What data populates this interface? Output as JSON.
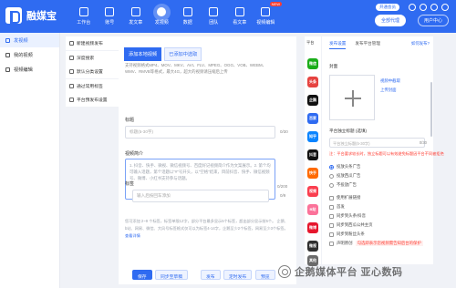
{
  "app": {
    "logo_text": "融媒宝"
  },
  "nav": [
    {
      "label": "工作台"
    },
    {
      "label": "账号"
    },
    {
      "label": "发文章"
    },
    {
      "label": "发视频"
    },
    {
      "label": "数据"
    },
    {
      "label": "团队"
    },
    {
      "label": "看文章"
    },
    {
      "label": "视频编辑",
      "badge": "NEW"
    }
  ],
  "top_right": {
    "vip": "开通会员",
    "all_button": "全部代理",
    "user_button": "用户中心"
  },
  "sidebar": [
    {
      "label": "发视频"
    },
    {
      "label": "我的视频"
    },
    {
      "label": "视频编辑"
    }
  ],
  "tools": [
    {
      "label": "新建视频发布"
    },
    {
      "label": "深度搜索"
    },
    {
      "label": "默认分类设置"
    },
    {
      "label": "通过常用标签"
    },
    {
      "label": "平台预发布设置"
    }
  ],
  "main": {
    "tab_local": "添加本地视频",
    "tab_selected": "已添加中选取",
    "formats": "支持视频格式MP4、MOV、MKV、AVI、FLV、MPEG、OGG、VOB、WEBM、WMV、RMVB等格式，最大4G，超大的视频请压缩后上传",
    "title_label": "标题",
    "title_placeholder": "标题(5-30字)",
    "title_counter": "0/30",
    "summary_label": "视频简介",
    "summary_placeholder": "1. 抖音、快手、微视、微信视频号、百度好记视频简介作为文案展示。2. 第个均可输入话题，第个话题以\"#\"号开头，以\"空格\"结束，目前抖音、快手、微信视频号、微博、小红书支持参与话题。",
    "summary_counter": "0/200",
    "tags_label": "标签",
    "tags_placeholder": "输入后按回车添加",
    "tags_counter": "0/9",
    "tips": "您可添加 2~9 个标签，标签单限12字，部分平台最多显示5个标签，超出部分显示前5个。 企鹅、b站、网易、微信、大风号标签格式仅可以为标签4-14字，企鹅至少2个标签，网易至少3个标签。",
    "tips_link": "查看详情"
  },
  "bottom_buttons": [
    {
      "label": "保存"
    },
    {
      "label": "同步至草稿"
    },
    {
      "label": "发布"
    },
    {
      "label": "定时发布"
    },
    {
      "label": "预览"
    }
  ],
  "platforms": {
    "label": "平台",
    "items": [
      {
        "name": "微信",
        "color": "#1aad19"
      },
      {
        "name": "头条",
        "color": "#e64340"
      },
      {
        "name": "企鹅",
        "color": "#111111"
      },
      {
        "name": "百家",
        "color": "#2f6bf1"
      },
      {
        "name": "知乎",
        "color": "#0a84ff"
      },
      {
        "name": "抖音",
        "color": "#111111"
      },
      {
        "name": "快手",
        "color": "#ff6a00"
      },
      {
        "name": "视频",
        "color": "#fa3e4f"
      },
      {
        "name": "B站",
        "color": "#fb7299"
      },
      {
        "name": "微博",
        "color": "#e6162d"
      },
      {
        "name": "微视",
        "color": "#2f2f2f"
      },
      {
        "name": "其他",
        "color": "#6a6a6a"
      }
    ]
  },
  "settings": {
    "tab_publish": "发布设置",
    "tab_platform": "发布平台管理",
    "help": "如何发布?",
    "cover_label": "封面",
    "cover_select": "视频中截取",
    "cover_upload": "上传封面",
    "platform_title_label": "平台独立标题 (选填)",
    "platform_title_placeholder": "平台独立标题(5-30字)",
    "platform_title_counter": "0/30",
    "warning": "注：平台要求较长时，独立标题可以有效避免标题因平台不同被拒绝",
    "radio_options": [
      {
        "label": "投放头条广告",
        "checked": true
      },
      {
        "label": "投放西瓜广告",
        "checked": false
      },
      {
        "label": "不投放广告",
        "checked": false
      }
    ],
    "checkbox_options": [
      {
        "label": "使用扩展链接"
      },
      {
        "label": "首发"
      },
      {
        "label": "同步到头条/抖音"
      },
      {
        "label": "同步到西瓜公共主页"
      },
      {
        "label": "同步到粉丝头条"
      },
      {
        "label": "声明原创",
        "chip": "勾选即表示您视频需告知后台的保护"
      }
    ]
  },
  "watermark": {
    "text": "企鹅媒体平台 亚心数码"
  }
}
